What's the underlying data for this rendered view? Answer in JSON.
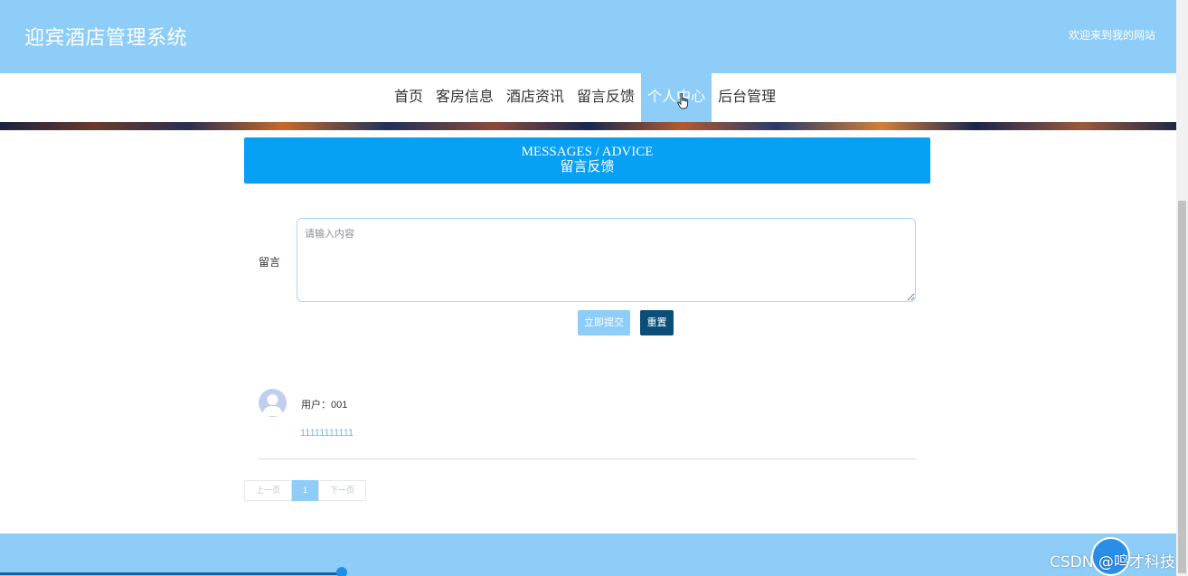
{
  "header": {
    "title": "迎宾酒店管理系统",
    "welcome": "欢迎来到我的网站"
  },
  "nav": {
    "items": [
      {
        "label": "首页"
      },
      {
        "label": "客房信息"
      },
      {
        "label": "酒店资讯"
      },
      {
        "label": "留言反馈"
      },
      {
        "label": "个人中心",
        "active": true
      },
      {
        "label": "后台管理"
      }
    ]
  },
  "section": {
    "title_en": "MESSAGES / ADVICE",
    "title_cn": "留言反馈"
  },
  "form": {
    "label": "留言",
    "placeholder": "请输入内容",
    "value": "",
    "submit_label": "立即提交",
    "reset_label": "重置"
  },
  "comments": [
    {
      "user": "用户：001",
      "content": "11111111111"
    }
  ],
  "pagination": {
    "prev_label": "上一页",
    "current_page": "1",
    "next_label": "下一页"
  },
  "watermark": "CSDN @鸣才科技",
  "colors": {
    "primary": "#8ecdf8",
    "section_bar": "#06a0f5",
    "reset_button": "#0b4f78"
  }
}
